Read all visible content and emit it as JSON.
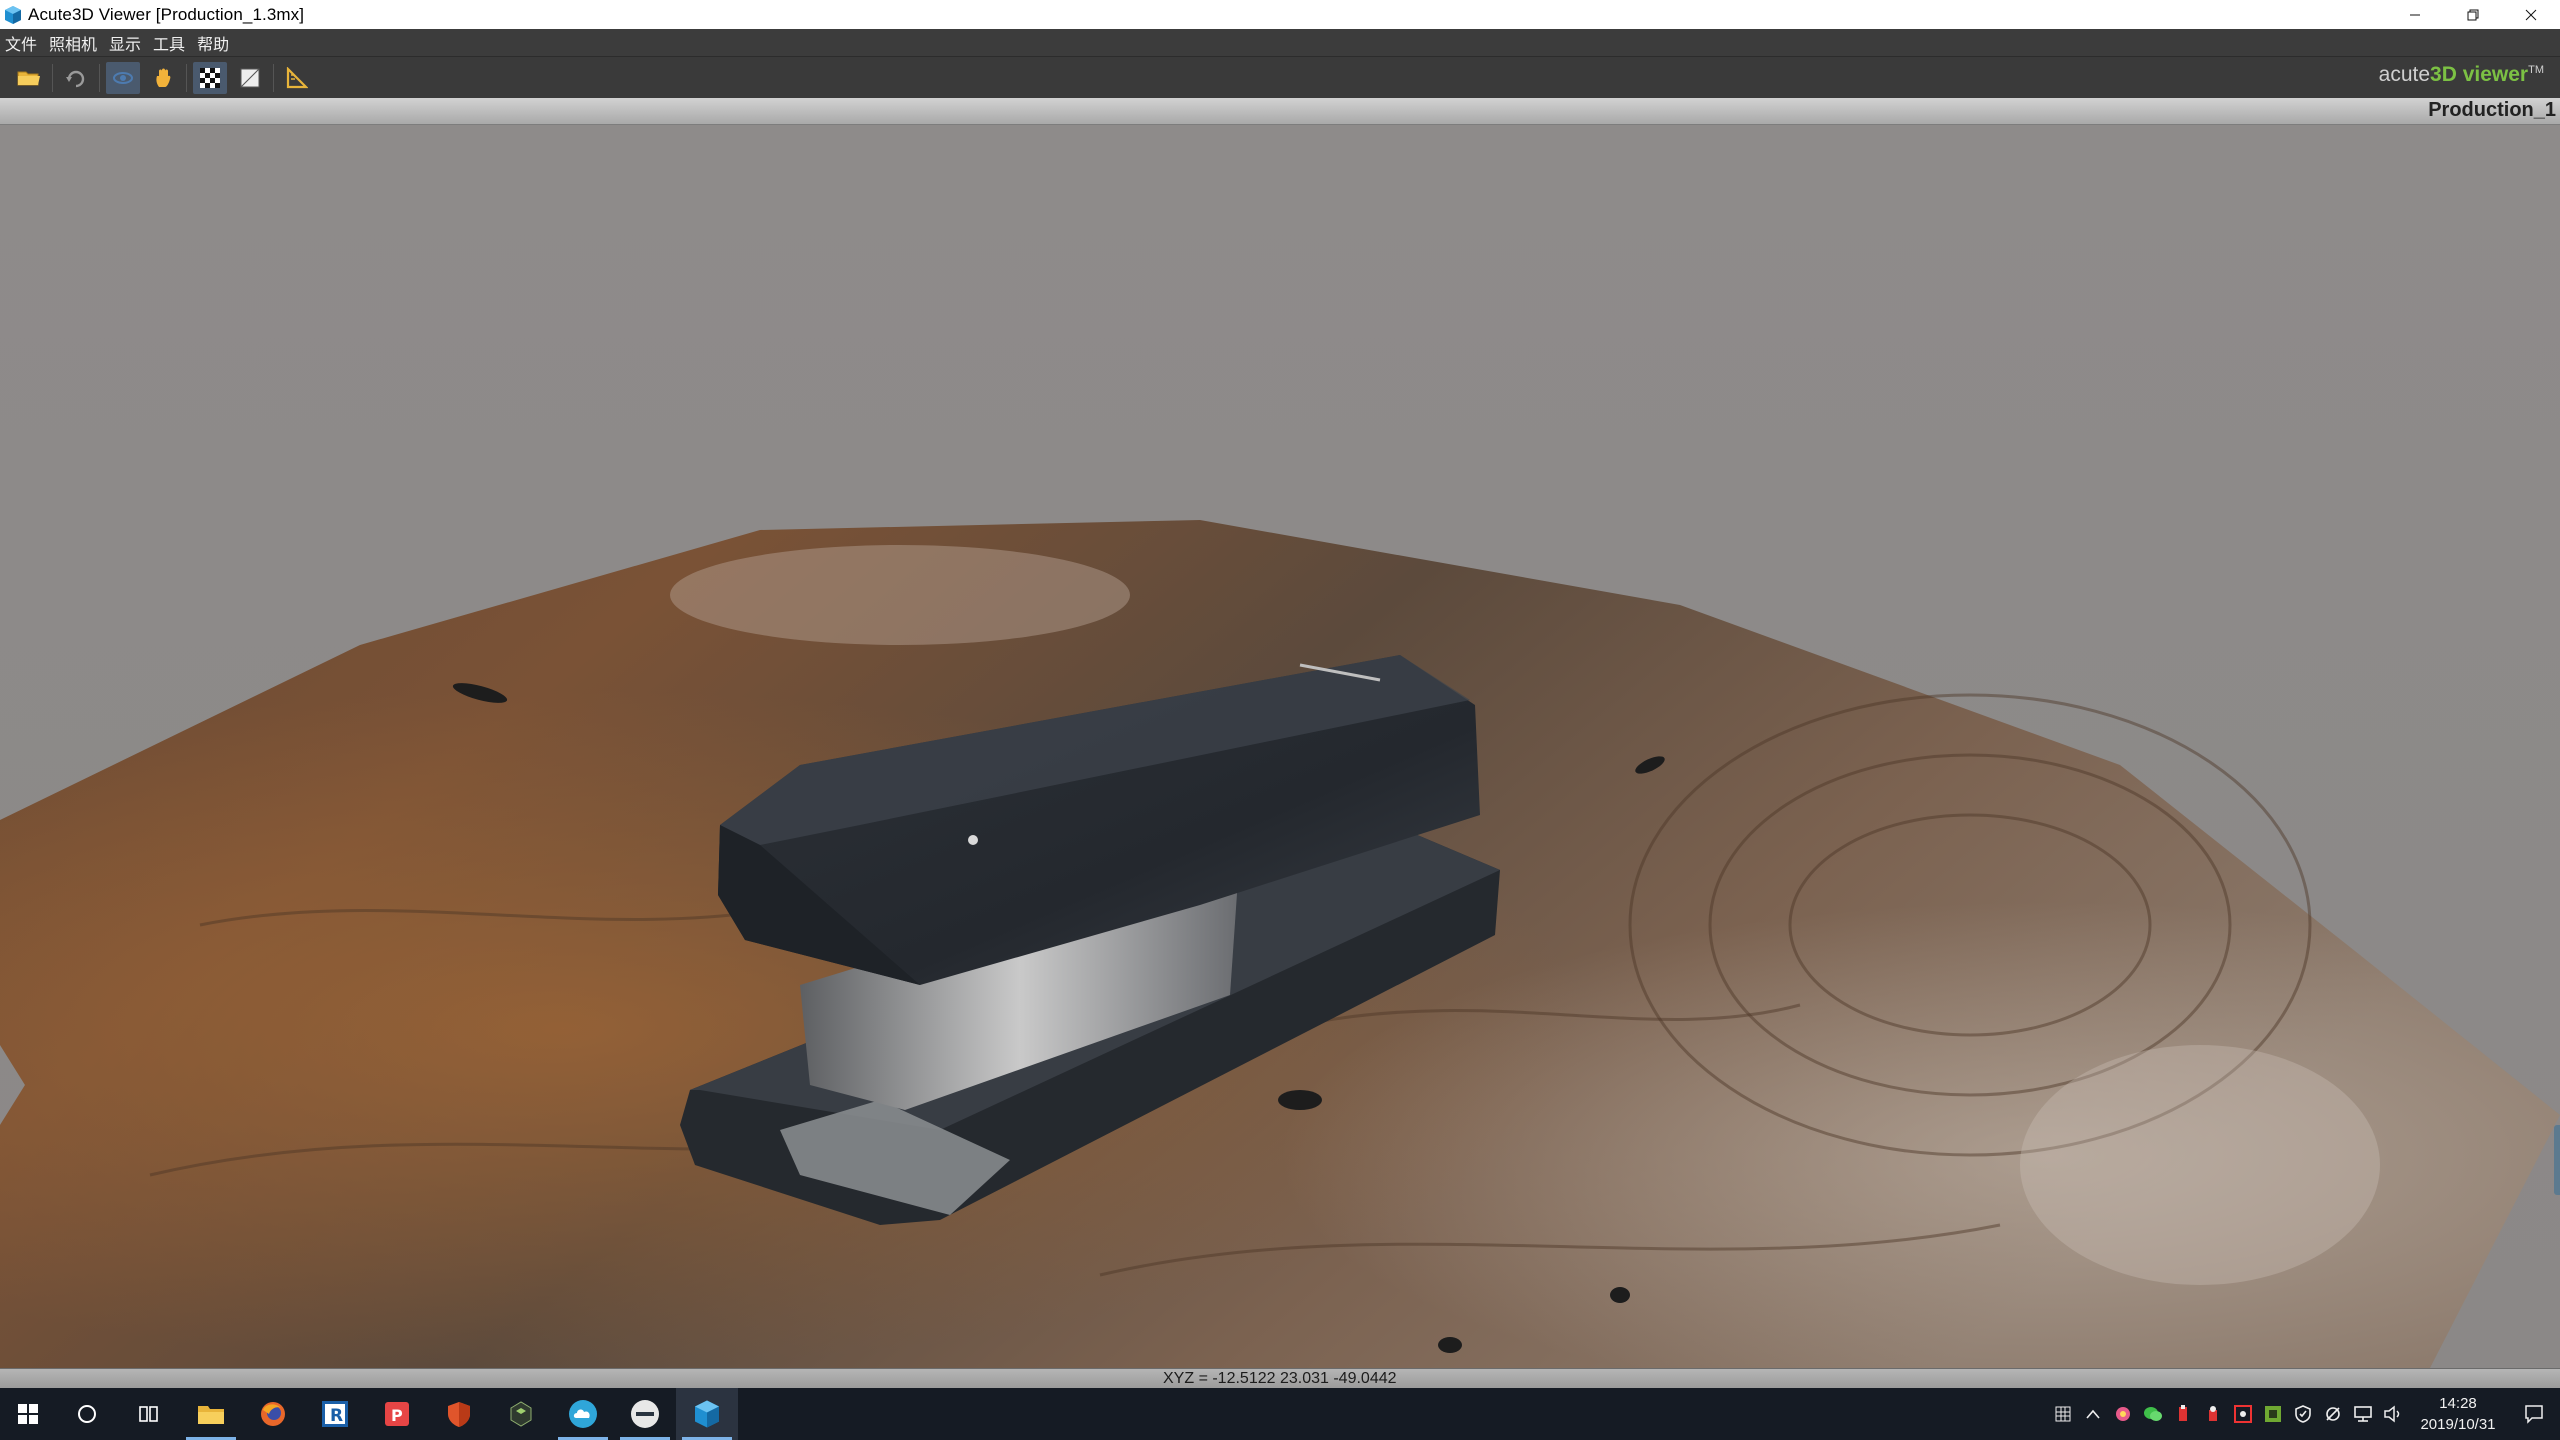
{
  "window": {
    "title": "Acute3D Viewer [Production_1.3mx]"
  },
  "menu": {
    "items": [
      "文件",
      "照相机",
      "显示",
      "工具",
      "帮助"
    ]
  },
  "toolbar": {
    "buttons": [
      {
        "icon": "open-folder-icon"
      },
      {
        "icon": "reset-view-icon"
      },
      {
        "icon": "orbit-icon"
      },
      {
        "icon": "pan-hand-icon"
      },
      {
        "icon": "checker-texture-icon"
      },
      {
        "icon": "wireframe-icon"
      },
      {
        "icon": "measure-icon"
      }
    ],
    "brand": {
      "prefix": "acute",
      "mid": "3D",
      "suffix": " viewer",
      "tm": "TM"
    }
  },
  "scene": {
    "name": "Production_1"
  },
  "status": {
    "coords": "XYZ = -12.5122 23.031 -49.0442"
  },
  "taskbar": {
    "apps": [
      {
        "icon": "windows-start-icon"
      },
      {
        "icon": "cortana-search-icon"
      },
      {
        "icon": "task-view-icon"
      },
      {
        "icon": "file-explorer-icon"
      },
      {
        "icon": "firefox-icon"
      },
      {
        "icon": "revit-icon"
      },
      {
        "icon": "pdf-reader-icon"
      },
      {
        "icon": "security-app-icon"
      },
      {
        "icon": "app-dark-icon"
      },
      {
        "icon": "cloud-app-icon"
      },
      {
        "icon": "disc-app-icon"
      },
      {
        "icon": "acute3d-viewer-icon"
      }
    ],
    "clock": {
      "time": "14:28",
      "date": "2019/10/31"
    }
  },
  "colors": {
    "viewport_bg": "#8f8c8b",
    "menubar_bg": "#3c3c3c",
    "brand_accent": "#7cc144",
    "taskbar_bg": "#151b24"
  }
}
